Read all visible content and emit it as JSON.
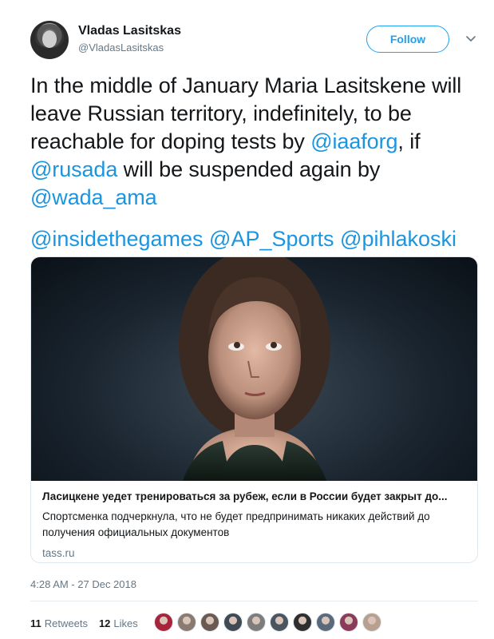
{
  "author": {
    "name": "Vladas Lasitskas",
    "handle": "@VladasLasitskas"
  },
  "follow_label": "Follow",
  "tweet": {
    "line1": "In the middle of January Maria Lasitskene will",
    "line2": "leave Russian territory, indefinitely, to be",
    "line3_pre": "reachable for doping tests by ",
    "mention_iaaf": "@iaaforg",
    "line3_post": ", if",
    "mention_rusada": "@rusada",
    "line4_post": " will be suspended again by",
    "mention_wada": "@wada_ama",
    "mention_insidethegames": "@insidethegames",
    "mention_ap": "@AP_Sports",
    "mention_pihlakoski": "@pihlakoski"
  },
  "card": {
    "title": "Ласицкене уедет тренироваться за рубеж, если в России будет закрыт до...",
    "description": "Спортсменка подчеркнула, что не будет предпринимать никаких действий до получения официальных документов",
    "domain": "tass.ru"
  },
  "timestamp": "4:28 AM - 27 Dec 2018",
  "stats": {
    "retweets_count": "11",
    "retweets_label": "Retweets",
    "likes_count": "12",
    "likes_label": "Likes"
  },
  "likers": [
    {
      "name": "liker-1",
      "color": "#a8243a"
    },
    {
      "name": "liker-2",
      "color": "#8a7a70"
    },
    {
      "name": "liker-3",
      "color": "#6b5a52"
    },
    {
      "name": "liker-4",
      "color": "#3f4a55"
    },
    {
      "name": "liker-5",
      "color": "#7d7d7d"
    },
    {
      "name": "liker-6",
      "color": "#4a5560"
    },
    {
      "name": "liker-7",
      "color": "#2f2f2f"
    },
    {
      "name": "liker-8",
      "color": "#5a6a7a"
    },
    {
      "name": "liker-9",
      "color": "#8c3a5a"
    },
    {
      "name": "liker-10",
      "color": "#b8a090"
    }
  ],
  "icons": {
    "chevron": "chevron-down-icon"
  }
}
